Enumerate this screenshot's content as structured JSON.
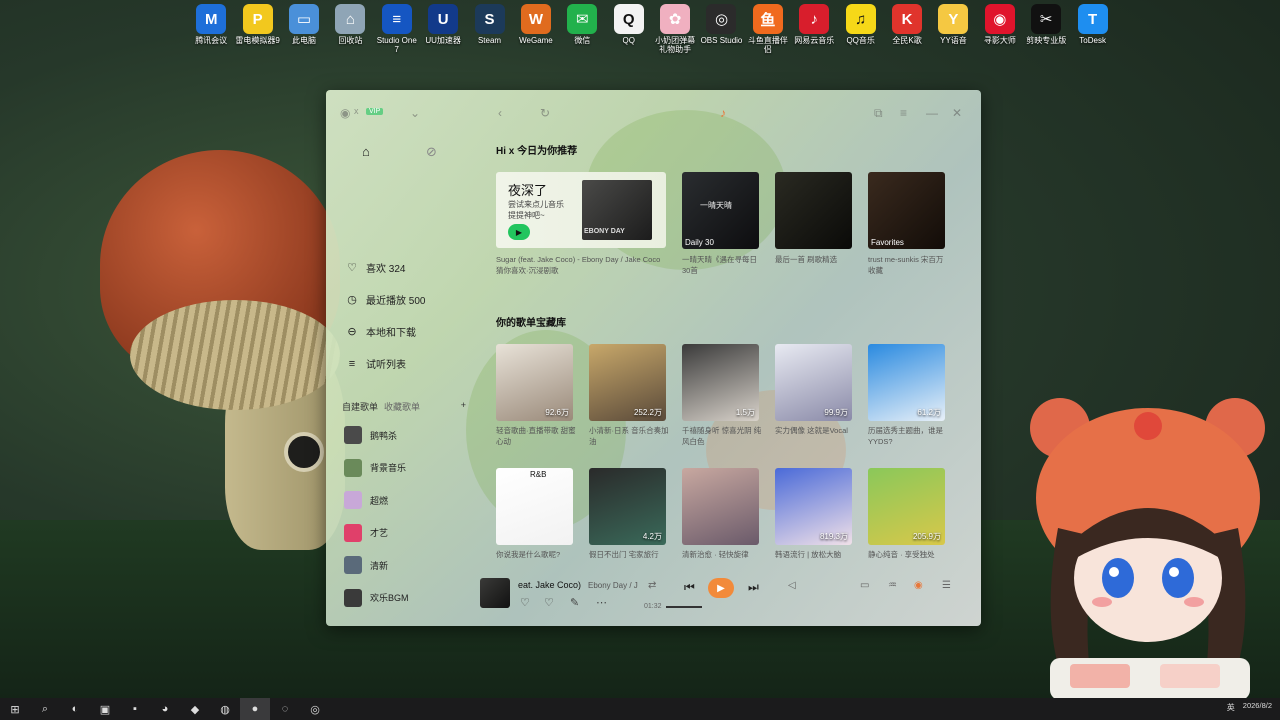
{
  "desktop_icons": [
    {
      "label": "腾讯会议",
      "color": "#1e6fd9",
      "glyph": "M"
    },
    {
      "label": "雷电模拟器9",
      "color": "#f2c81e",
      "glyph": "P"
    },
    {
      "label": "此电脑",
      "color": "#4a90d9",
      "glyph": "▭"
    },
    {
      "label": "回收站",
      "color": "#8fa5b6",
      "glyph": "⌂"
    },
    {
      "label": "Studio One 7",
      "color": "#1556c2",
      "glyph": "≡"
    },
    {
      "label": "UU加速器",
      "color": "#123a8a",
      "glyph": "U"
    },
    {
      "label": "Steam",
      "color": "#1c3a5a",
      "glyph": "S"
    },
    {
      "label": "WeGame",
      "color": "#e06b1e",
      "glyph": "W"
    },
    {
      "label": "微信",
      "color": "#22b14c",
      "glyph": "✉"
    },
    {
      "label": "QQ",
      "color": "#f3f3f3",
      "glyph": "Q"
    },
    {
      "label": "小奶团弹幕礼物助手",
      "color": "#f0b0c0",
      "glyph": "✿"
    },
    {
      "label": "OBS Studio",
      "color": "#2b2b2b",
      "glyph": "◎"
    },
    {
      "label": "斗鱼直播伴侣",
      "color": "#f06a1e",
      "glyph": "鱼"
    },
    {
      "label": "网易云音乐",
      "color": "#d81e2c",
      "glyph": "♪"
    },
    {
      "label": "QQ音乐",
      "color": "#f6d818",
      "glyph": "♫"
    },
    {
      "label": "全民K歌",
      "color": "#e0342c",
      "glyph": "K"
    },
    {
      "label": "YY语音",
      "color": "#f5c842",
      "glyph": "Y"
    },
    {
      "label": "寻影大师",
      "color": "#e0142c",
      "glyph": "◉"
    },
    {
      "label": "剪映专业版",
      "color": "#111111",
      "glyph": "✂"
    },
    {
      "label": "ToDesk",
      "color": "#1e8ef0",
      "glyph": "T"
    }
  ],
  "titlebar": {
    "user": "x",
    "badge": "VIP"
  },
  "sidebar": {
    "nav": [
      {
        "label": "喜欢 324",
        "icon": "heart-icon",
        "glyph": "♡"
      },
      {
        "label": "最近播放 500",
        "icon": "clock-icon",
        "glyph": "◷"
      },
      {
        "label": "本地和下载",
        "icon": "download-icon",
        "glyph": "⊖"
      },
      {
        "label": "试听列表",
        "icon": "list-icon",
        "glyph": "≡"
      }
    ],
    "section_tabs": [
      "自建歌单",
      "收藏歌单"
    ],
    "playlists": [
      {
        "label": "鹅鸭杀",
        "color": "#4a4a4a"
      },
      {
        "label": "背景音乐",
        "color": "#6a8a5a"
      },
      {
        "label": "超燃",
        "color": "#c8a8d8"
      },
      {
        "label": "才艺",
        "color": "#e0406a"
      },
      {
        "label": "清新",
        "color": "#5a6a7a"
      },
      {
        "label": "欢乐BGM",
        "color": "#3a3a3a"
      }
    ]
  },
  "main": {
    "greeting": "Hi x 今日为你推荐",
    "banner": {
      "title": "夜深了",
      "subtitle": "尝试来点儿音乐提提神吧~",
      "disc_label": "EBONY DAY"
    },
    "recommend": [
      {
        "badge": "Daily 30",
        "color1": "#2a2d30",
        "color2": "#0d0d0f",
        "mark": "一晴天晴",
        "caption": "一晴天晴《遇在寻每日30首"
      },
      {
        "badge": "",
        "color1": "#2a2a22",
        "color2": "#0a0a08",
        "mark": "",
        "caption": "最后一首 刷歌精选"
      },
      {
        "badge": "Favorites",
        "color1": "#3a2a1e",
        "color2": "#120c08",
        "mark": "",
        "caption": "trust me-sunkis 宋百万收藏"
      }
    ],
    "banner_caption": "Sugar (feat. Jake Coco) - Ebony Day / Jake Coco 猜你喜欢·沉浸剧歌",
    "library_title": "你的歌单宝藏库",
    "row1": [
      {
        "count": "92.6万",
        "caption": "轻音歌曲·直播带歌 甜蜜心动",
        "c1": "#e8e2d8",
        "c2": "#9a8a7a"
      },
      {
        "count": "252.2万",
        "caption": "小清新·日系 音乐合奏加油",
        "c1": "#c8a86a",
        "c2": "#5a4a3a"
      },
      {
        "count": "1.5万",
        "caption": "千禧随身听 惊喜光阴 纯风白色",
        "c1": "#3a3a3a",
        "c2": "#d8d2ca"
      },
      {
        "count": "99.9万",
        "caption": "实力偶像 这就是Vocal",
        "c1": "#e8eaf2",
        "c2": "#8a8aa8"
      },
      {
        "count": "61.2万",
        "caption": "历届选秀主题曲，谁是YYDS?",
        "c1": "#2a8ae0",
        "c2": "#e8f0f8"
      }
    ],
    "row2": [
      {
        "count": "",
        "caption": "你说我是什么歌呢?",
        "c1": "#ffffff",
        "c2": "#f2f2f2",
        "text": "R&B"
      },
      {
        "count": "4.2万",
        "caption": "假日不出门 宅家旅行",
        "c1": "#2a2a2a",
        "c2": "#3a6a5a",
        "text": ""
      },
      {
        "count": "",
        "caption": "清新治愈 · 轻快旋律",
        "c1": "#c8a8a0",
        "c2": "#6a5a6a",
        "text": ""
      },
      {
        "count": "819.3万",
        "caption": "韩语流行 | 放松大脑",
        "c1": "#4a6ad8",
        "c2": "#f0e0e8",
        "text": ""
      },
      {
        "count": "205.9万",
        "caption": "静心纯音 · 享受独处",
        "c1": "#8ac85a",
        "c2": "#d8c84a",
        "text": ""
      }
    ]
  },
  "player": {
    "title": "eat. Jake Coco)",
    "artist": "Ebony Day / J",
    "time": "01:32"
  },
  "taskbar": {
    "time": "2026/8/2",
    "lang": "英"
  }
}
